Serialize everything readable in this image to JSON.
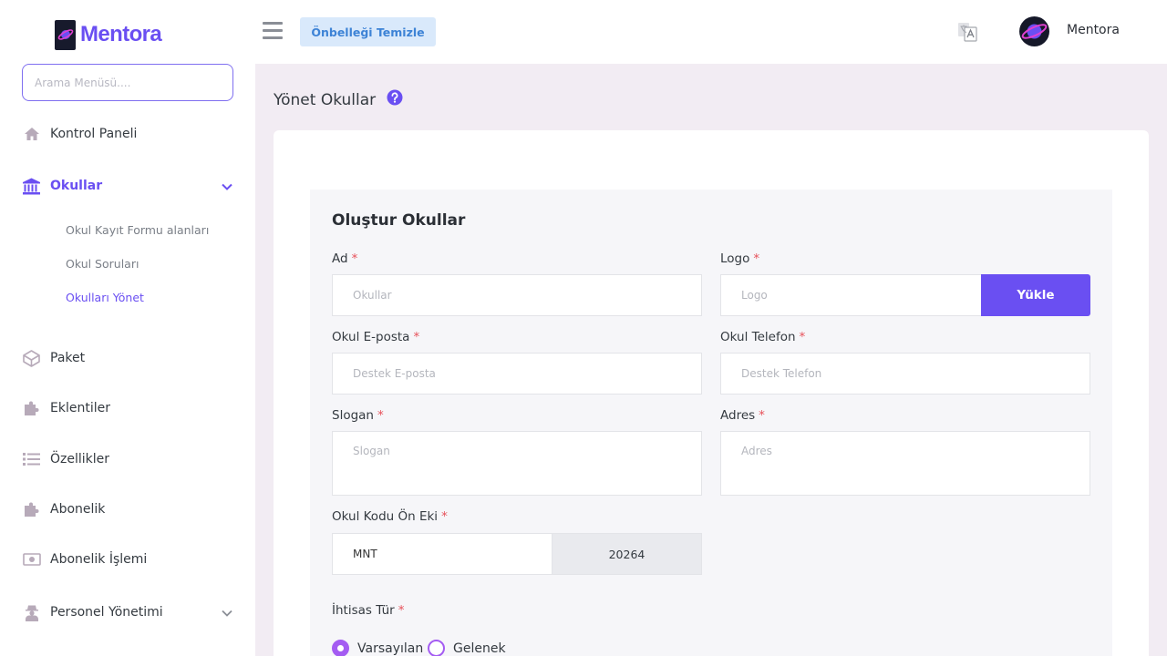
{
  "app": {
    "name": "Mentora"
  },
  "sidebar": {
    "search_placeholder": "Arama Menüsü....",
    "items": [
      {
        "label": "Kontrol Paneli",
        "icon": "home-icon"
      },
      {
        "label": "Okullar",
        "icon": "school-building-icon",
        "active": true,
        "expanded": true
      },
      {
        "label": "Paket",
        "icon": "package-icon"
      },
      {
        "label": "Eklentiler",
        "icon": "puzzle-icon"
      },
      {
        "label": "Özellikler",
        "icon": "list-icon"
      },
      {
        "label": "Abonelik",
        "icon": "puzzle-icon"
      },
      {
        "label": "Abonelik İşlemi",
        "icon": "money-icon"
      },
      {
        "label": "Personel Yönetimi",
        "icon": "user-secret-icon"
      }
    ],
    "sub_items": [
      {
        "label": "Okul Kayıt Formu alanları"
      },
      {
        "label": "Okul Soruları"
      },
      {
        "label": "Okulları Yönet",
        "active": true
      }
    ]
  },
  "header": {
    "cache_button": "Önbelleği Temizle",
    "user_name": "Mentora"
  },
  "page": {
    "title": "Yönet Okullar"
  },
  "form": {
    "title": "Oluştur Okullar",
    "required_marker": "*",
    "fields": {
      "name": {
        "label": "Ad",
        "placeholder": "Okullar"
      },
      "logo": {
        "label": "Logo",
        "placeholder": "Logo",
        "button": "Yükle"
      },
      "email": {
        "label": "Okul E-posta",
        "placeholder": "Destek E-posta"
      },
      "phone": {
        "label": "Okul Telefon",
        "placeholder": "Destek Telefon"
      },
      "slogan": {
        "label": "Slogan",
        "placeholder": "Slogan"
      },
      "address": {
        "label": "Adres",
        "placeholder": "Adres"
      },
      "code_prefix": {
        "label": "Okul Kodu Ön Eki",
        "value": "MNT",
        "suffix": "20264"
      },
      "specialty_type": {
        "label": "İhtisas Tür",
        "options": [
          "Varsayılan",
          "Gelenek"
        ],
        "selected": "Varsayılan"
      }
    }
  },
  "colors": {
    "accent": "#6a4ff2",
    "radio": "#a45cf2",
    "required": "#e7515a",
    "background": "#f2ecf3"
  }
}
